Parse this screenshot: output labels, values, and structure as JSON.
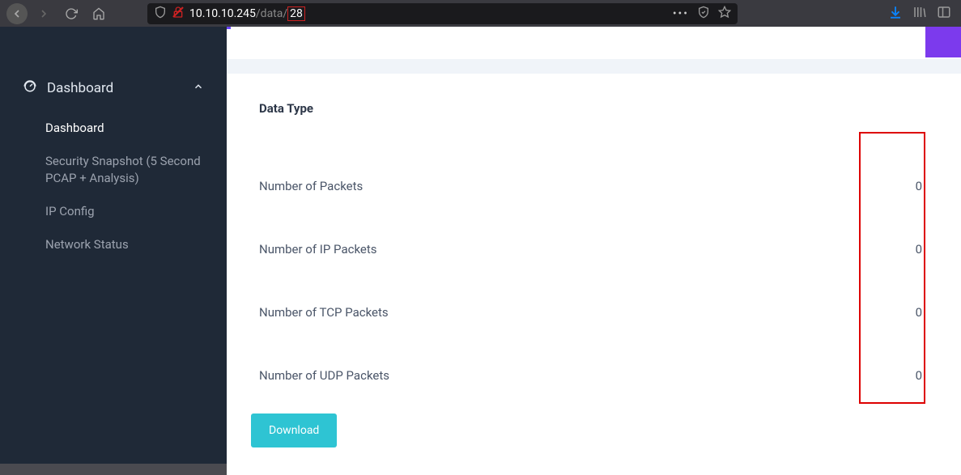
{
  "url": {
    "host": "10.10.10.245",
    "path_prefix": "/data/",
    "path_highlight": "28"
  },
  "sidebar": {
    "header": "Dashboard",
    "items": [
      {
        "label": "Dashboard",
        "active": true
      },
      {
        "label": "Security Snapshot (5 Second PCAP + Analysis)",
        "active": false
      },
      {
        "label": "IP Config",
        "active": false
      },
      {
        "label": "Network Status",
        "active": false
      }
    ]
  },
  "main": {
    "panel_title": "Data Type",
    "rows": [
      {
        "label": "Number of Packets",
        "value": "0"
      },
      {
        "label": "Number of IP Packets",
        "value": "0"
      },
      {
        "label": "Number of TCP Packets",
        "value": "0"
      },
      {
        "label": "Number of UDP Packets",
        "value": "0"
      }
    ],
    "download_label": "Download"
  }
}
